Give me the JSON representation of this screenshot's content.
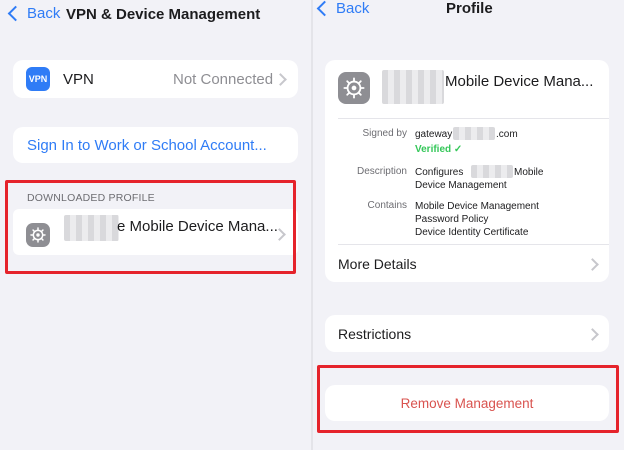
{
  "left": {
    "nav": {
      "back_label": "Back",
      "title": "VPN & Device Management"
    },
    "vpn": {
      "icon_text": "VPN",
      "label": "VPN",
      "status": "Not Connected"
    },
    "signin": {
      "label": "Sign In to Work or School Account..."
    },
    "downloaded": {
      "section_label": "DOWNLOADED PROFILE",
      "profile_name_suffix": "e Mobile Device Mana..."
    }
  },
  "right": {
    "nav": {
      "back_label": "Back",
      "title": "Profile"
    },
    "profile": {
      "title_suffix": "Mobile Device Mana...",
      "signed_by_label": "Signed by",
      "signed_by_prefix": "gateway",
      "signed_by_suffix": ".com",
      "verified_label": "Verified",
      "verified_check": "✓",
      "description_label": "Description",
      "description_prefix": "Configures",
      "description_suffix": "Mobile",
      "description_line2": "Device Management",
      "contains_label": "Contains",
      "contains": [
        "Mobile Device Management",
        "Password Policy",
        "Device Identity Certificate"
      ],
      "more_details": "More Details"
    },
    "restrictions": {
      "label": "Restrictions"
    },
    "remove": {
      "label": "Remove Management"
    }
  },
  "colors": {
    "accent": "#2f7cf6",
    "destructive": "#d9534f",
    "highlight": "#e5232b",
    "verified": "#34c759"
  }
}
